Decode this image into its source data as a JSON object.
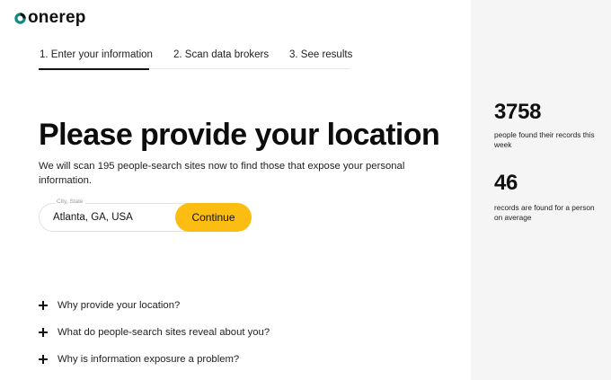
{
  "brand": {
    "name": "onerep",
    "logo_color": "#0f8a8a"
  },
  "steps": [
    {
      "label": "1. Enter your information",
      "active": true
    },
    {
      "label": "2. Scan data brokers",
      "active": false
    },
    {
      "label": "3. See results",
      "active": false
    }
  ],
  "main": {
    "title": "Please provide your location",
    "description": "We will scan 195 people-search sites now to find those that expose your personal information."
  },
  "location": {
    "label": "City, State",
    "value": "Atlanta, GA, USA",
    "button_label": "Continue",
    "button_color": "#fbbd12"
  },
  "faq": [
    {
      "question": "Why provide your location?",
      "icon": "plus-icon"
    },
    {
      "question": "What do people-search sites reveal about you?",
      "icon": "plus-icon"
    },
    {
      "question": "Why is information exposure a problem?",
      "icon": "plus-icon"
    }
  ],
  "stats": [
    {
      "value": "3758",
      "label": "people found their records this week"
    },
    {
      "value": "46",
      "label": "records are found for a person on average"
    }
  ]
}
